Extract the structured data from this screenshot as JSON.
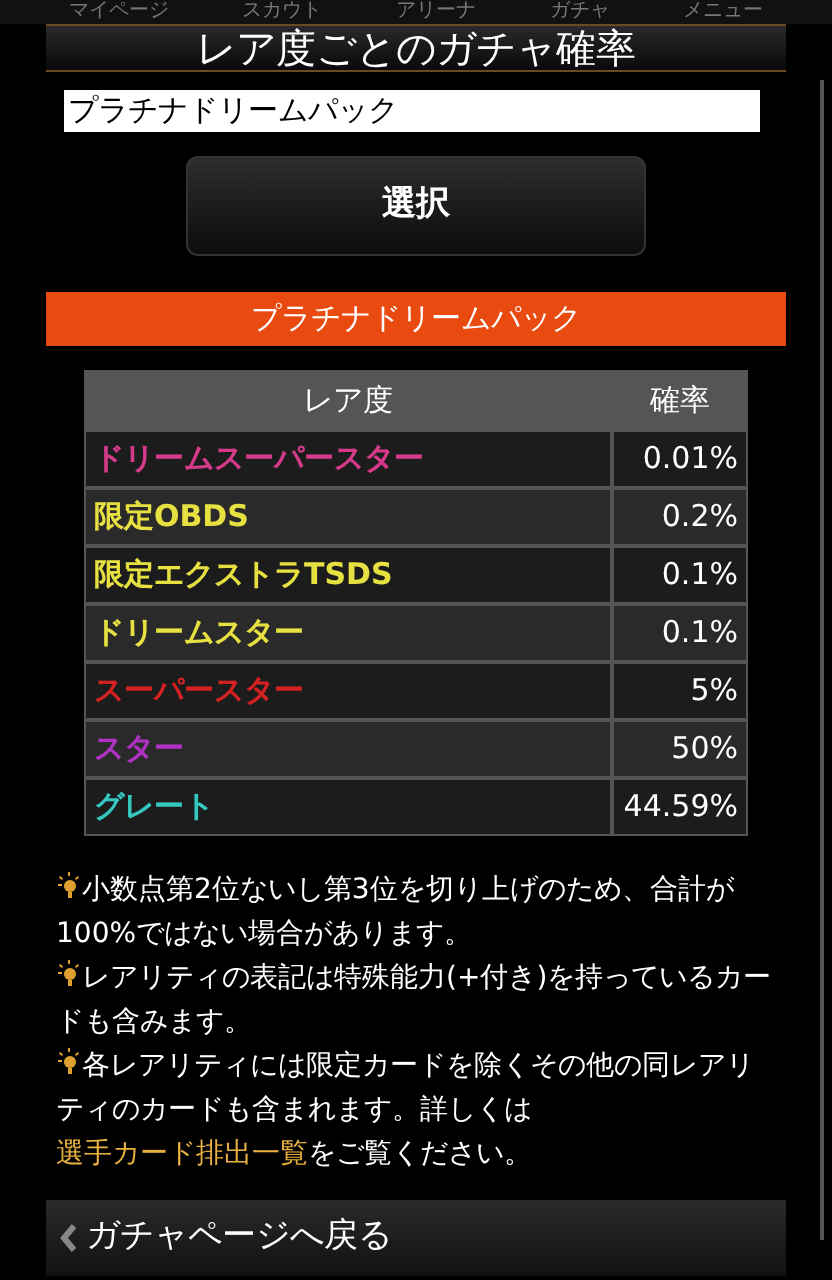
{
  "nav": [
    "マイページ",
    "スカウト",
    "アリーナ",
    "ガチャ",
    "メニュー"
  ],
  "title": "レア度ごとのガチャ確率",
  "pack_select": {
    "value": "プラチナドリームパック"
  },
  "select_button": "選択",
  "pack_banner": "プラチナドリームパック",
  "table": {
    "columns": [
      "レア度",
      "確率"
    ],
    "rows": [
      {
        "rarity": "ドリームスーパースター",
        "rate": "0.01%",
        "color": "#d63a8a"
      },
      {
        "rarity": "限定OBDS",
        "rate": "0.2%",
        "color": "#e6e040"
      },
      {
        "rarity": "限定エクストラTSDS",
        "rate": "0.1%",
        "color": "#e6e040"
      },
      {
        "rarity": "ドリームスター",
        "rate": "0.1%",
        "color": "#e6e040"
      },
      {
        "rarity": "スーパースター",
        "rate": "5%",
        "color": "#d42222"
      },
      {
        "rarity": "スター",
        "rate": "50%",
        "color": "#b032c4"
      },
      {
        "rarity": "グレート",
        "rate": "44.59%",
        "color": "#34c8c0"
      }
    ]
  },
  "notes": [
    {
      "text": "小数点第2位ないし第3位を切り上げのため、合計が100%ではない場合があります。"
    },
    {
      "text": "レアリティの表記は特殊能力(+付き)を持っているカードも含みます。"
    },
    {
      "text": "各レアリティには限定カードを除くその他の同レアリティのカードも含まれます。詳しくは",
      "link": "選手カード排出一覧",
      "after": "をご覧ください。"
    }
  ],
  "back_link": "ガチャページへ戻る"
}
